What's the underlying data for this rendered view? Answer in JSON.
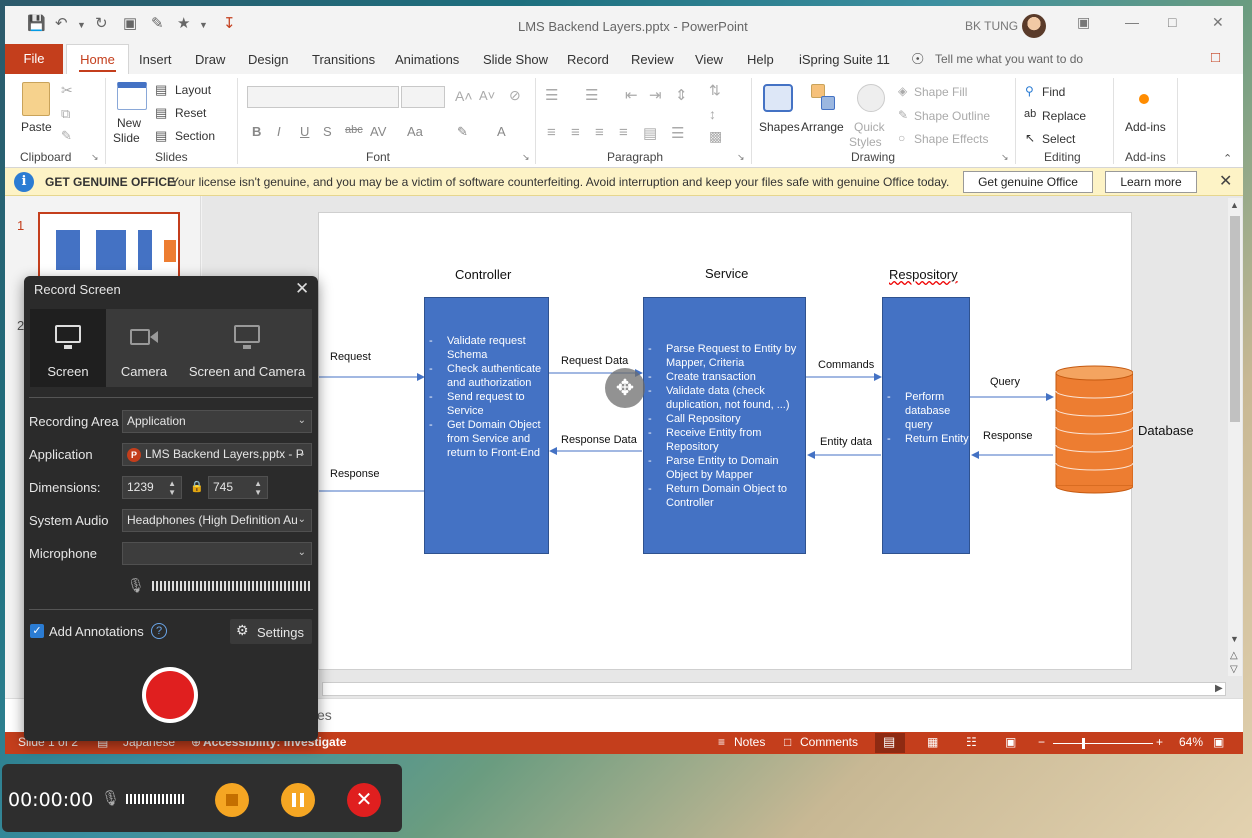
{
  "window": {
    "title": "LMS Backend Layers.pptx  -  PowerPoint",
    "user": "BK TUNG"
  },
  "tabs": [
    "File",
    "Home",
    "Insert",
    "Draw",
    "Design",
    "Transitions",
    "Animations",
    "Slide Show",
    "Record",
    "Review",
    "View",
    "Help",
    "iSpring Suite 11"
  ],
  "tellme_placeholder": "Tell me what you want to do",
  "ribbon": {
    "clipboard": {
      "label": "Clipboard",
      "paste": "Paste"
    },
    "slides": {
      "label": "Slides",
      "new_slide_1": "New",
      "new_slide_2": "Slide",
      "layout": "Layout",
      "reset": "Reset",
      "section": "Section"
    },
    "font": {
      "label": "Font"
    },
    "paragraph": {
      "label": "Paragraph"
    },
    "drawing": {
      "label": "Drawing",
      "shapes": "Shapes",
      "arrange": "Arrange",
      "quick_1": "Quick",
      "quick_2": "Styles",
      "shape_fill": "Shape Fill",
      "shape_outline": "Shape Outline",
      "shape_effects": "Shape Effects"
    },
    "editing": {
      "label": "Editing",
      "find": "Find",
      "replace": "Replace",
      "select": "Select"
    },
    "addins": {
      "label": "Add-ins",
      "button": "Add-ins"
    }
  },
  "infobar": {
    "title": "GET GENUINE OFFICE",
    "message": "Your license isn't genuine, and you may be a victim of software counterfeiting. Avoid interruption and keep your files safe with genuine Office today.",
    "btn_genuine": "Get genuine Office",
    "btn_learn": "Learn more"
  },
  "thumbs": {
    "n1": "1",
    "n2": "2"
  },
  "slide": {
    "headers": {
      "controller": "Controller",
      "service": "Service",
      "repository": "Respository",
      "database": "Database"
    },
    "controller_items": [
      "Validate request Schema",
      "Check authenticate and authorization",
      "Send request to Service",
      "Get Domain Object from Service and return to Front-End"
    ],
    "service_items": [
      "Parse Request to Entity by Mapper, Criteria",
      "Create transaction",
      "Validate data (check duplication, not found, ...)",
      "Call Repository",
      "Receive Entity from Repository",
      "Parse Entity to Domain Object by Mapper",
      "Return Domain Object to Controller"
    ],
    "repository_items": [
      "Perform database query",
      "Return Entity"
    ],
    "arrows": {
      "request": "Request",
      "response": "Response",
      "request_data": "Request Data",
      "response_data": "Response Data",
      "commands": "Commands",
      "entity_data": "Entity data",
      "query": "Query",
      "db_response": "Response"
    }
  },
  "notes_placeholder": "es",
  "status": {
    "slide": "Slide 1 of 2",
    "language": "Japanese",
    "accessibility": "Accessibility: Investigate",
    "notes": "Notes",
    "comments": "Comments",
    "zoom": "64%"
  },
  "record_panel": {
    "title": "Record Screen",
    "modes": [
      "Screen",
      "Camera",
      "Screen and Camera"
    ],
    "recording_area_label": "Recording Area",
    "recording_area_value": "Application",
    "application_label": "Application",
    "application_value": "LMS Backend Layers.pptx - P",
    "dimensions_label": "Dimensions:",
    "width": "1239",
    "height": "745",
    "audio_label": "System Audio",
    "audio_value": "Headphones (High Definition Au",
    "mic_label": "Microphone",
    "mic_value": "",
    "annotations_label": "Add Annotations",
    "settings_label": "Settings"
  },
  "recorder_bar": {
    "time": "00:00:00"
  },
  "colors": {
    "accent": "#c43e1c",
    "box": "#4472c4",
    "db": "#ed7d31",
    "record": "#e01f1f"
  }
}
